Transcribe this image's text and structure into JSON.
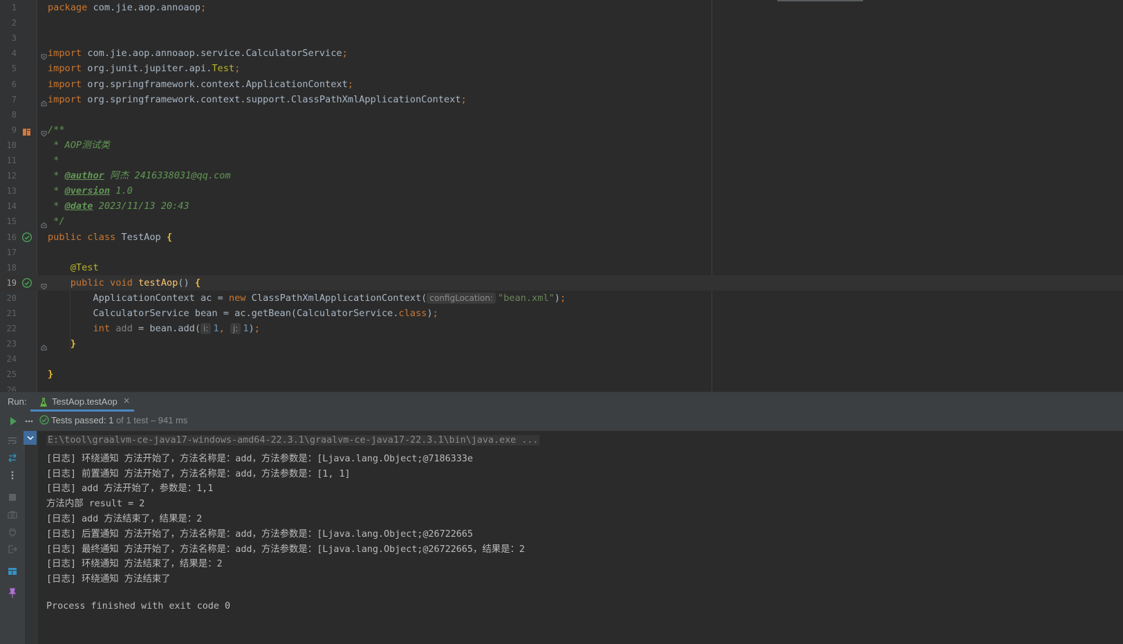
{
  "editor": {
    "lines": [
      {
        "n": "1",
        "html": "<span class=\"kw\">package </span>com.jie.aop.annoaop<span class=\"pun\">;</span>"
      },
      {
        "n": "2",
        "html": ""
      },
      {
        "n": "3",
        "html": ""
      },
      {
        "n": "4",
        "html": "<span class=\"kw\">import </span>com.jie.aop.annoaop.service.CalculatorService<span class=\"pun\">;</span>"
      },
      {
        "n": "5",
        "html": "<span class=\"kw\">import </span>org.junit.jupiter.api.<span class=\"ann\">Test</span><span class=\"pun\">;</span>"
      },
      {
        "n": "6",
        "html": "<span class=\"kw\">import </span>org.springframework.context.ApplicationContext<span class=\"pun\">;</span>"
      },
      {
        "n": "7",
        "html": "<span class=\"kw\">import </span>org.springframework.context.support.ClassPathXmlApplicationContext<span class=\"pun\">;</span>"
      },
      {
        "n": "8",
        "html": ""
      },
      {
        "n": "9",
        "html": "<span class=\"cm\">/**</span>"
      },
      {
        "n": "10",
        "html": "<span class=\"cm\"> * AOP测试类</span>"
      },
      {
        "n": "11",
        "html": "<span class=\"cm\"> *</span>"
      },
      {
        "n": "12",
        "html": "<span class=\"cm\"> * </span><span class=\"tag\">@author</span><span class=\"cm\"> 阿杰 2416338031@qq.com</span>"
      },
      {
        "n": "13",
        "html": "<span class=\"cm\"> * </span><span class=\"tag\">@version</span><span class=\"cm\"> 1.0</span>"
      },
      {
        "n": "14",
        "html": "<span class=\"cm\"> * </span><span class=\"tag\">@date</span><span class=\"cm\"> 2023/11/13 20:43</span>"
      },
      {
        "n": "15",
        "html": "<span class=\"cm\"> */</span>"
      },
      {
        "n": "16",
        "html": "<span class=\"kw\">public class </span>TestAop <span class=\"br\">{</span>"
      },
      {
        "n": "17",
        "html": ""
      },
      {
        "n": "18",
        "html": "    <span class=\"ann\">@Test</span>"
      },
      {
        "n": "19",
        "html": "    <span class=\"kw\">public void </span><span class=\"fn\">testAop</span>() <span class=\"br\">{</span>"
      },
      {
        "n": "20",
        "html": "        ApplicationContext ac = <span class=\"kw\">new </span>ClassPathXmlApplicationContext(<span class=\"hint\">configLocation:</span><span class=\"str\">\"bean.xml\"</span>)<span class=\"pun\">;</span>"
      },
      {
        "n": "21",
        "html": "        CalculatorService bean = ac.getBean(CalculatorService.<span class=\"kw\">class</span>)<span class=\"pun\">;</span>"
      },
      {
        "n": "22",
        "html": "        <span class=\"kw\">int </span><span class=\"dim\">add</span> = bean.add(<span class=\"hint\">i:</span><span class=\"num\">1</span><span class=\"pun\">, </span><span class=\"hint\">j:</span><span class=\"num\">1</span>)<span class=\"pun\">;</span>"
      },
      {
        "n": "23",
        "html": "    <span class=\"br\">}</span>"
      },
      {
        "n": "24",
        "html": ""
      },
      {
        "n": "25",
        "html": "<span class=\"br\">}</span>"
      },
      {
        "n": "26",
        "html": ""
      }
    ]
  },
  "run_panel": {
    "label": "Run:",
    "tab_label": "TestAop.testAop",
    "tab_close": "×",
    "status_prefix": "Tests passed: ",
    "status_count": "1",
    "status_extra": " of 1 test – 941 ms"
  },
  "console": {
    "lines": [
      "E:\\tool\\graalvm-ce-java17-windows-amd64-22.3.1\\graalvm-ce-java17-22.3.1\\bin\\java.exe ...",
      "[日志] 环绕通知 方法开始了，方法名称是：add，方法参数是：[Ljava.lang.Object;@7186333e",
      "[日志] 前置通知 方法开始了，方法名称是：add，方法参数是：[1, 1]",
      "[日志] add 方法开始了，参数是：1,1",
      "方法内部 result = 2",
      "[日志] add 方法结束了，结果是：2",
      "[日志] 后置通知 方法开始了，方法名称是：add，方法参数是：[Ljava.lang.Object;@26722665",
      "[日志] 最终通知 方法开始了，方法名称是：add，方法参数是：[Ljava.lang.Object;@26722665，结果是：2",
      "[日志] 环绕通知 方法结束了，结果是：2",
      "[日志] 环绕通知 方法结束了",
      "",
      "Process finished with exit code 0"
    ]
  },
  "colors": {
    "editor_bg": "#2b2b2b",
    "gutter_bg": "#313335",
    "panel_bg": "#3c3f41",
    "accent": "#4a88c7",
    "pass_green": "#499c54"
  }
}
